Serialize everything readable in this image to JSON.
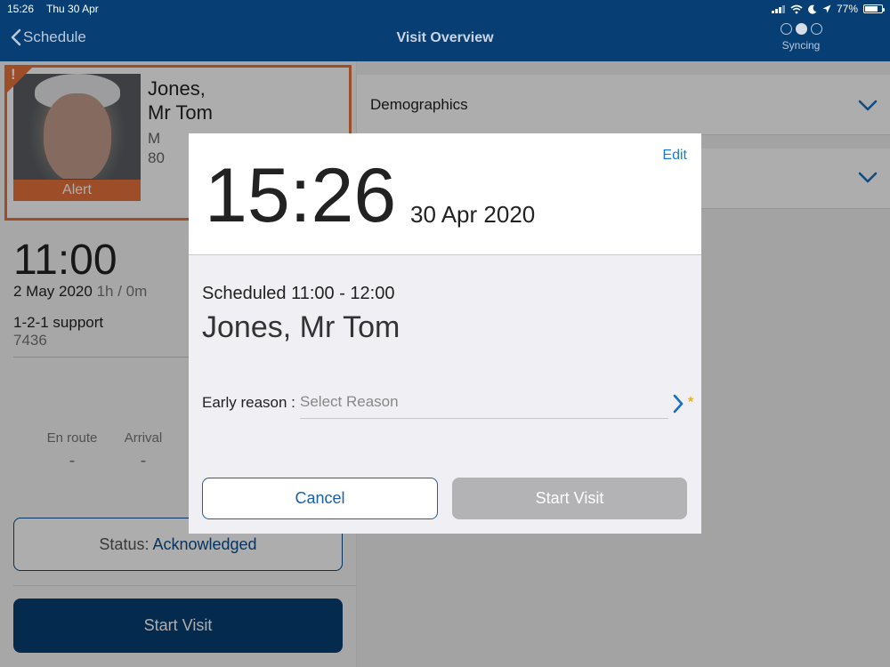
{
  "status_bar": {
    "time": "15:26",
    "date": "Thu 30 Apr",
    "battery": "77%",
    "battery_level": 0.77,
    "icons": [
      "signal-icon",
      "wifi-icon",
      "moon-icon",
      "location-icon",
      "battery-icon"
    ]
  },
  "nav": {
    "back_label": "Schedule",
    "title": "Visit Overview",
    "sync_label": "Syncing",
    "sync_dots_active": 2
  },
  "patient": {
    "name_line1": "Jones,",
    "name_line2": "Mr Tom",
    "gender": "M",
    "age": "80",
    "alert_label": "Alert",
    "alert_mark": "!"
  },
  "visit": {
    "time": "11:00",
    "date": "2 May 2020",
    "duration": "1h / 0m",
    "service": "1-2-1 support",
    "code": "7436",
    "enroute_label": "En route",
    "enroute_value": "-",
    "arrival_label": "Arrival",
    "arrival_value": "-",
    "status_prefix": "Status:",
    "status_value": "Acknowledged",
    "start_label": "Start Visit"
  },
  "right_panel": {
    "sections": [
      {
        "label": "Demographics"
      },
      {
        "label": ""
      }
    ]
  },
  "modal": {
    "edit_label": "Edit",
    "time": "15:26",
    "date": "30 Apr 2020",
    "scheduled": "Scheduled 11:00 - 12:00",
    "name": "Jones, Mr Tom",
    "reason_label": "Early reason :",
    "reason_placeholder": "Select Reason",
    "required_mark": "*",
    "cancel_label": "Cancel",
    "start_label": "Start Visit"
  },
  "colors": {
    "header": "#073e73",
    "alert": "#e8743b",
    "link": "#1a7bd6",
    "required": "#e6b12c",
    "disabled_button": "#b3b3b6"
  }
}
